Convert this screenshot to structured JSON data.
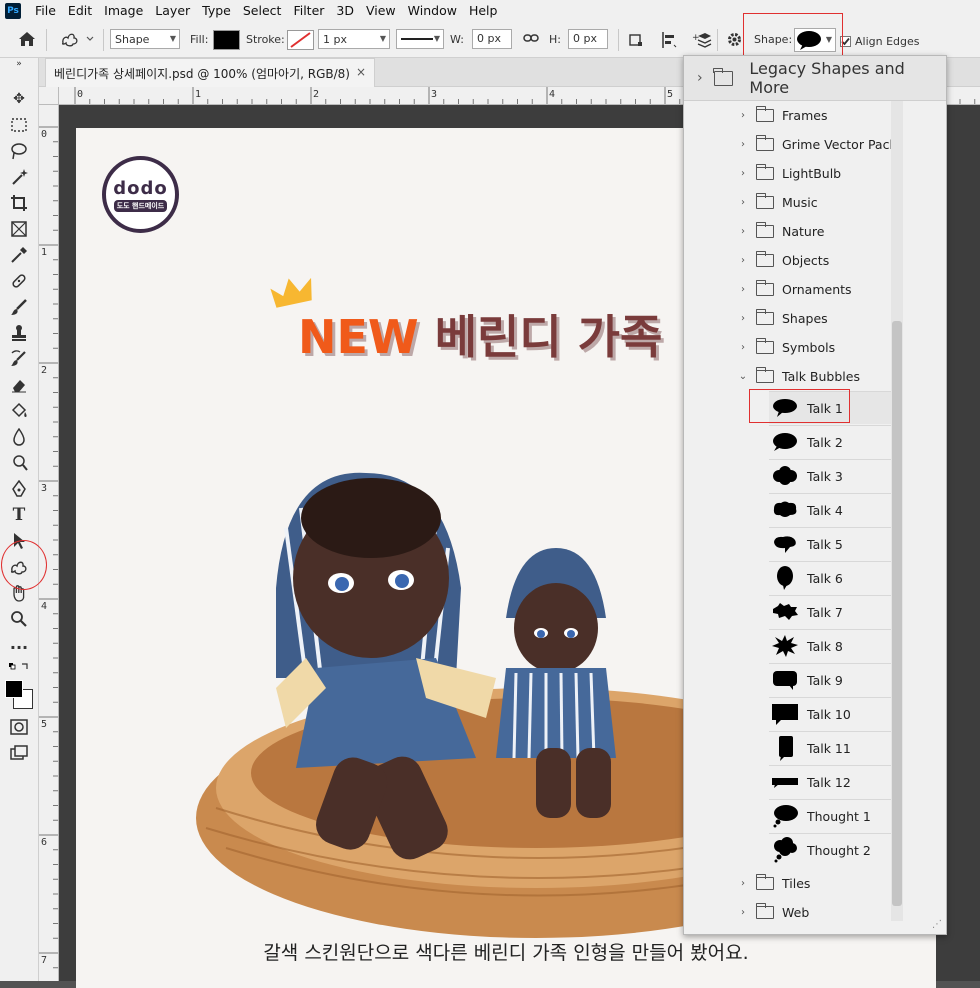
{
  "menubar": {
    "logo": "Ps",
    "items": [
      "File",
      "Edit",
      "Image",
      "Layer",
      "Type",
      "Select",
      "Filter",
      "3D",
      "View",
      "Window",
      "Help"
    ]
  },
  "options": {
    "mode": "Shape",
    "fill_label": "Fill:",
    "stroke_label": "Stroke:",
    "stroke_width": "1 px",
    "w_label": "W:",
    "w_value": "0 px",
    "h_label": "H:",
    "h_value": "0 px",
    "shape_label": "Shape:",
    "align_edges_label": "Align Edges",
    "align_edges_checked": true
  },
  "doc_tab": {
    "title": "베린디가족 상세페이지.psd @ 100% (엄마아기, RGB/8)",
    "close": "×"
  },
  "rulers": {
    "top": [
      "0",
      "1",
      "2",
      "3",
      "4",
      "5"
    ],
    "left": [
      "0",
      "1",
      "2",
      "3",
      "4",
      "5",
      "6",
      "7"
    ]
  },
  "artboard": {
    "logo_text": "dodo",
    "logo_sub": "도도 핸드메이드",
    "headline_new": "NEW",
    "headline_rest": "베린디 가족",
    "caption": "갈색 스킨원단으로 색다른 베린디 가족 인형을 만들어 봤어요."
  },
  "shapes_panel": {
    "header": "Legacy Shapes and More",
    "folders": [
      "Frames",
      "Grime Vector Pack",
      "LightBulb",
      "Music",
      "Nature",
      "Objects",
      "Ornaments",
      "Shapes",
      "Symbols",
      "Talk Bubbles"
    ],
    "expanded_folder": "Talk Bubbles",
    "shapes": [
      "Talk 1",
      "Talk 2",
      "Talk 3",
      "Talk 4",
      "Talk 5",
      "Talk 6",
      "Talk 7",
      "Talk 8",
      "Talk 9",
      "Talk 10",
      "Talk 11",
      "Talk 12",
      "Thought 1",
      "Thought 2"
    ],
    "selected_shape": "Talk 1",
    "after_folders": [
      "Tiles",
      "Web"
    ]
  },
  "colors": {
    "highlight": "#e03030",
    "accent_orange": "#f05a1a",
    "headline_brown": "#7a3b3b"
  }
}
